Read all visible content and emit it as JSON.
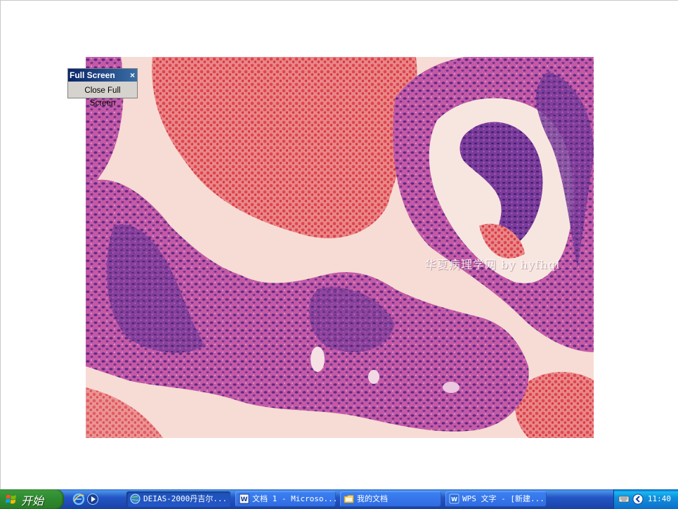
{
  "viewer": {
    "watermark": "华夏病理学网 by hyfhql"
  },
  "fullscreen_toolbar": {
    "title": "Full Screen",
    "close_glyph": "×",
    "close_button_label": "Close Full Screen"
  },
  "taskbar": {
    "start_label": "开始",
    "quick_launch": [
      "ie-icon",
      "media-icon"
    ],
    "tasks": [
      {
        "label": "DEIAS-2000丹吉尔...",
        "icon": "globe-icon",
        "active": true
      },
      {
        "label": "文档 1 - Microso...",
        "icon": "word-icon",
        "active": false
      },
      {
        "label": "我的文档",
        "icon": "folder-icon",
        "active": false
      },
      {
        "label": "WPS 文字 - [新建...",
        "icon": "wps-icon",
        "active": false
      }
    ],
    "tray": {
      "icons": [
        "keyboard-icon",
        "back-arrow-icon"
      ],
      "clock": "11:40"
    }
  },
  "colors": {
    "taskbar_blue": "#2456c7",
    "start_green": "#2f8a2f",
    "tissue_purple": "#8a3a9a",
    "blood_red": "#e0525a"
  }
}
